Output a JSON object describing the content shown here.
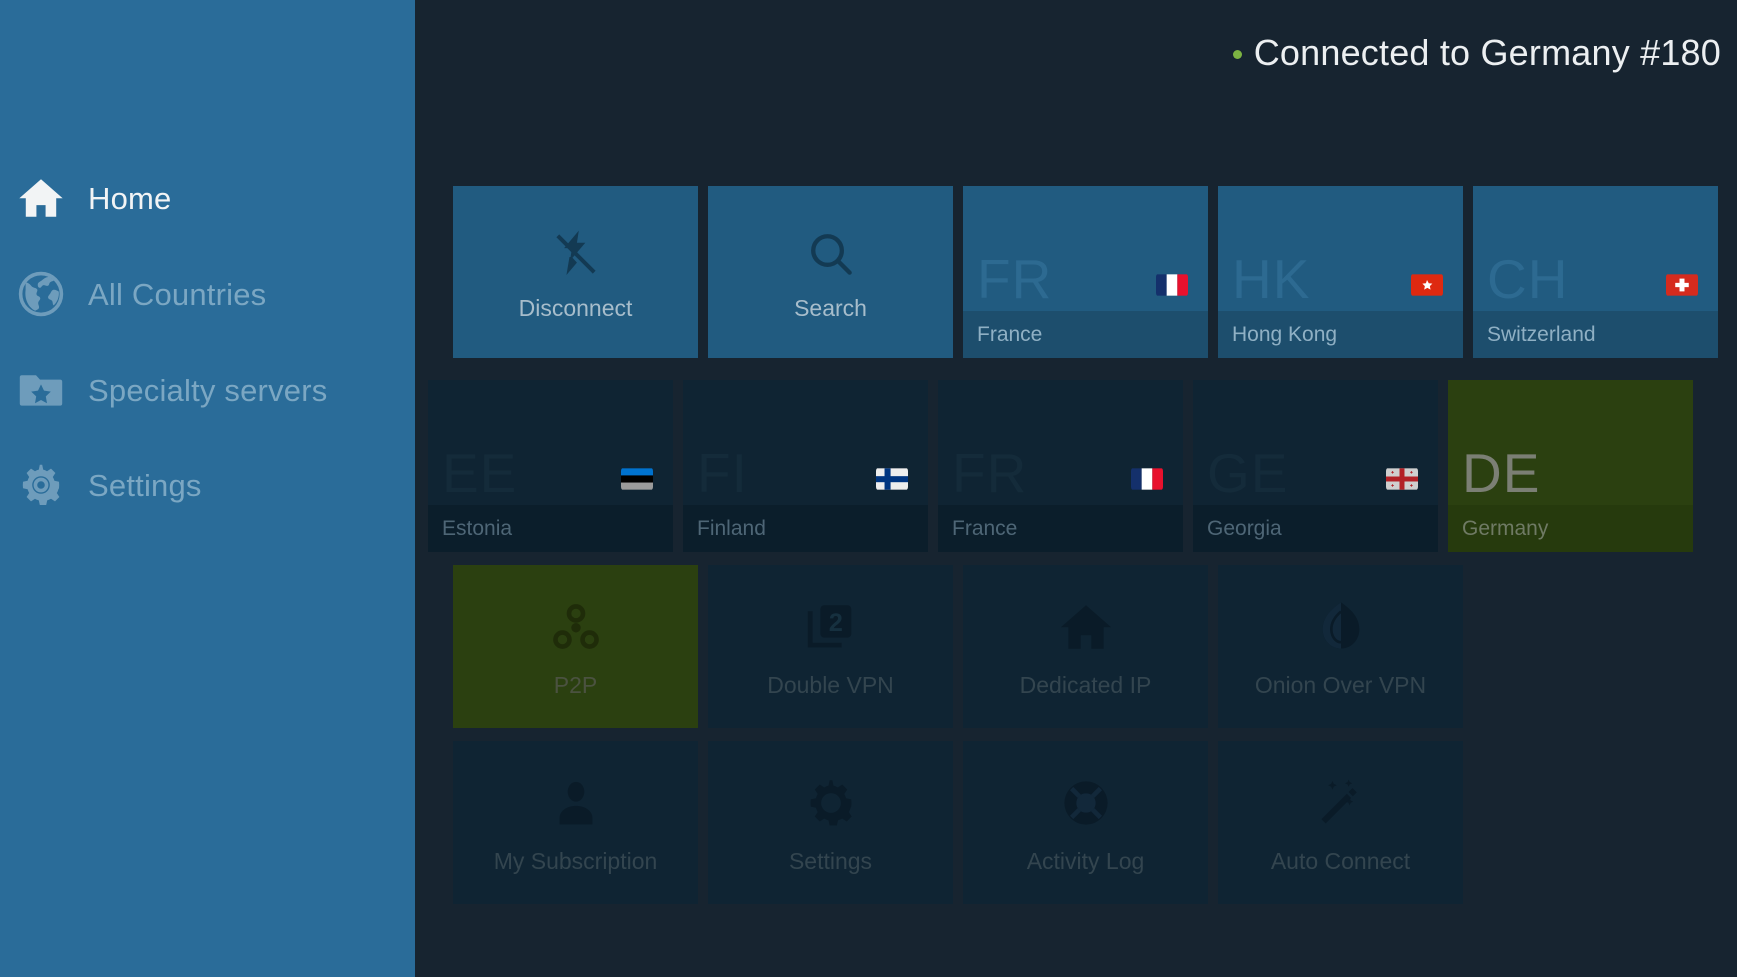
{
  "sidebar": {
    "items": [
      {
        "label": "Home",
        "icon": "home-icon",
        "active": true
      },
      {
        "label": "All Countries",
        "icon": "globe-icon",
        "active": false
      },
      {
        "label": "Specialty servers",
        "icon": "folder-star-icon",
        "active": false
      },
      {
        "label": "Settings",
        "icon": "gear-icon",
        "active": false
      }
    ],
    "bg_color": "#2a6c99"
  },
  "header": {
    "status_text": "Connected to Germany #180",
    "status_dot_color": "#7cb342"
  },
  "quick_actions": [
    {
      "label": "Disconnect",
      "icon": "bolt-slash-icon"
    },
    {
      "label": "Search",
      "icon": "search-icon"
    }
  ],
  "recommended_countries": [
    {
      "code": "FR",
      "name": "France",
      "flag": "flag-fr"
    },
    {
      "code": "HK",
      "name": "Hong Kong",
      "flag": "flag-hk"
    },
    {
      "code": "CH",
      "name": "Switzerland",
      "flag": "flag-ch"
    }
  ],
  "recent_countries": [
    {
      "code": "EE",
      "name": "Estonia",
      "flag": "flag-ee",
      "selected": false
    },
    {
      "code": "FI",
      "name": "Finland",
      "flag": "flag-fi",
      "selected": false
    },
    {
      "code": "FR",
      "name": "France",
      "flag": "flag-fr",
      "selected": false
    },
    {
      "code": "GE",
      "name": "Georgia",
      "flag": "flag-ge",
      "selected": false
    },
    {
      "code": "DE",
      "name": "Germany",
      "flag": "flag-de",
      "selected": true
    }
  ],
  "specialty_servers": [
    {
      "label": "P2P",
      "icon": "share-nodes-icon",
      "selected": true
    },
    {
      "label": "Double VPN",
      "icon": "double-vpn-icon",
      "selected": false
    },
    {
      "label": "Dedicated IP",
      "icon": "house-icon",
      "selected": false
    },
    {
      "label": "Onion Over VPN",
      "icon": "onion-icon",
      "selected": false
    }
  ],
  "tools": [
    {
      "label": "My Subscription",
      "icon": "person-icon"
    },
    {
      "label": "Settings",
      "icon": "gear-icon"
    },
    {
      "label": "Activity Log",
      "icon": "lifebuoy-icon"
    },
    {
      "label": "Auto Connect",
      "icon": "magic-wand-icon"
    }
  ],
  "colors": {
    "app_background": "#172430",
    "sidebar": "#2a6c99",
    "tile_focused": "#215b80",
    "tile_dim": "#0f2433",
    "tile_selected": "#2b4010",
    "accent_green": "#7cb342"
  }
}
